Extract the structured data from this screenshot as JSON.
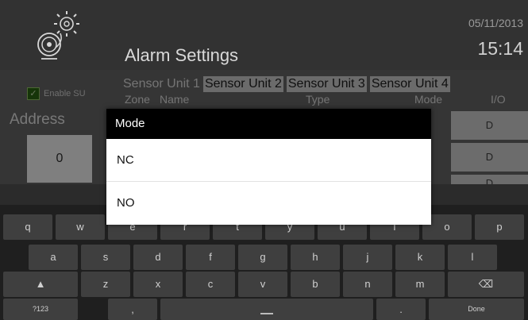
{
  "header": {
    "title": "Alarm Settings",
    "date": "05/11/2013",
    "time": "15:14",
    "icon": "bell-alarm-icon"
  },
  "background": {
    "enable_label": "Enable SU",
    "enable_checked": true,
    "address_label": "Address",
    "address_value": "0",
    "tabs": [
      "Sensor Unit 1",
      "Sensor Unit 2",
      "Sensor Unit 3",
      "Sensor Unit 4"
    ],
    "active_tab_index": 0,
    "columns": [
      "Zone",
      "Name",
      "Type",
      "Mode",
      "I/O"
    ],
    "row_io": [
      "D",
      "D",
      "D"
    ]
  },
  "dialog": {
    "title": "Mode",
    "options": [
      "NC",
      "NO"
    ]
  },
  "keyboard": {
    "row1": [
      "q",
      "w",
      "e",
      "r",
      "t",
      "y",
      "u",
      "i",
      "o",
      "p"
    ],
    "row2": [
      "a",
      "s",
      "d",
      "f",
      "g",
      "h",
      "j",
      "k",
      "l"
    ],
    "row3": [
      "shift",
      "z",
      "x",
      "c",
      "v",
      "b",
      "n",
      "m",
      "backspace"
    ],
    "row4": [
      "?123",
      ",",
      "space",
      ".",
      "Done"
    ]
  }
}
